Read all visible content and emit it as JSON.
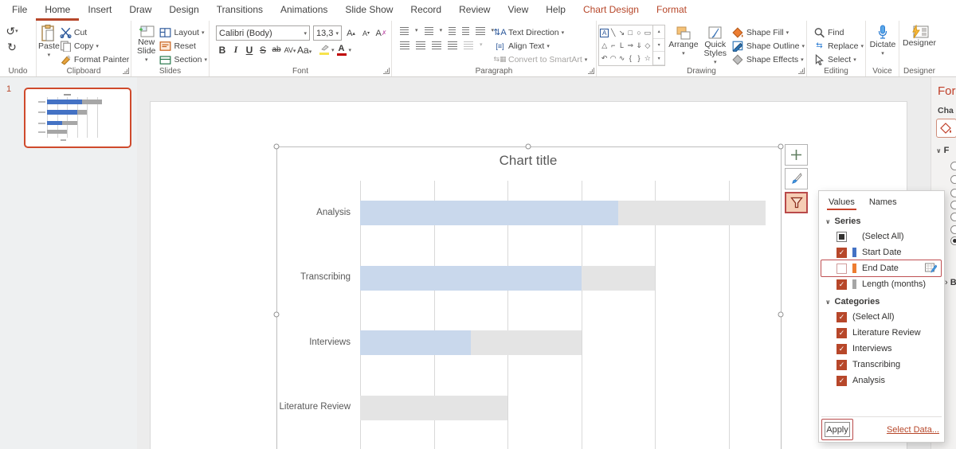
{
  "window": {
    "accent": "#b7472a",
    "workspace_bg": "#ececec"
  },
  "ribbon": {
    "tabs": [
      {
        "label": "File"
      },
      {
        "label": "Home",
        "active": true
      },
      {
        "label": "Insert"
      },
      {
        "label": "Draw"
      },
      {
        "label": "Design"
      },
      {
        "label": "Transitions"
      },
      {
        "label": "Animations"
      },
      {
        "label": "Slide Show"
      },
      {
        "label": "Record"
      },
      {
        "label": "Review"
      },
      {
        "label": "View"
      },
      {
        "label": "Help"
      },
      {
        "label": "Chart Design",
        "contextual": true
      },
      {
        "label": "Format",
        "contextual": true
      }
    ],
    "undo": {
      "group_label": "Undo"
    },
    "clipboard": {
      "group_label": "Clipboard",
      "paste": "Paste",
      "cut": "Cut",
      "copy": "Copy",
      "format_painter": "Format Painter"
    },
    "slides": {
      "group_label": "Slides",
      "new_slide": "New Slide",
      "layout": "Layout",
      "reset": "Reset",
      "section": "Section"
    },
    "font": {
      "group_label": "Font",
      "font_name": "Calibri (Body)",
      "font_size": "13,3",
      "bold": "B",
      "italic": "I",
      "underline": "U",
      "strike": "S",
      "kerning": "AV",
      "case": "Aa",
      "subscript": "ab"
    },
    "paragraph": {
      "group_label": "Paragraph",
      "text_direction": "Text Direction",
      "align_text": "Align Text",
      "convert_smartart": "Convert to SmartArt"
    },
    "drawing": {
      "group_label": "Drawing",
      "arrange": "Arrange",
      "quick_styles": "Quick Styles",
      "shape_fill": "Shape Fill",
      "shape_outline": "Shape Outline",
      "shape_effects": "Shape Effects"
    },
    "editing": {
      "group_label": "Editing",
      "find": "Find",
      "replace": "Replace",
      "select": "Select"
    },
    "voice": {
      "group_label": "Voice",
      "dictate": "Dictate"
    },
    "designer": {
      "group_label": "Designer",
      "designer": "Designer"
    }
  },
  "slide_panel": {
    "slide_number": "1"
  },
  "chart_data": {
    "type": "bar",
    "orientation": "horizontal",
    "stacked": true,
    "title": "Chart title",
    "categories": [
      "Analysis",
      "Transcribing",
      "Interviews",
      "Literature Review"
    ],
    "series": [
      {
        "name": "Start Date",
        "color_main": "#c9d8ec",
        "color_thumb": "#4472c4",
        "values": [
          3.5,
          3,
          1.5,
          0
        ]
      },
      {
        "name": "Length (months)",
        "color_main": "#e4e4e4",
        "color_thumb": "#a6a6a6",
        "values": [
          2,
          1,
          1.5,
          2
        ]
      }
    ],
    "hidden_series": [
      "End Date"
    ],
    "x_gridline_unit_months": 1,
    "x_gridline_count": 6,
    "xlim": [
      0,
      5.7
    ],
    "legend": "none",
    "grid": "vertical-only"
  },
  "filter_panel": {
    "tabs": [
      {
        "label": "Values",
        "active": true
      },
      {
        "label": "Names",
        "active": false
      }
    ],
    "series_header": "Series",
    "series": [
      {
        "label": "(Select All)",
        "state": "indeterminate"
      },
      {
        "label": "Start Date",
        "state": "checked",
        "swatch": "#4472c4"
      },
      {
        "label": "End Date",
        "state": "unchecked",
        "swatch": "#ed7d31",
        "highlighted": true,
        "has_edit_icon": true
      },
      {
        "label": "Length (months)",
        "state": "checked",
        "swatch": "#a6a6a6"
      }
    ],
    "categories_header": "Categories",
    "categories": [
      {
        "label": "(Select All)",
        "state": "checked"
      },
      {
        "label": "Literature Review",
        "state": "checked"
      },
      {
        "label": "Interviews",
        "state": "checked"
      },
      {
        "label": "Transcribing",
        "state": "checked"
      },
      {
        "label": "Analysis",
        "state": "checked"
      }
    ],
    "apply_label": "Apply",
    "select_data_label": "Select Data..."
  },
  "format_pane": {
    "title_visible": "For",
    "subtitle_visible": "Cha",
    "fill_section_visible": "F",
    "border_section_visible": "B"
  }
}
